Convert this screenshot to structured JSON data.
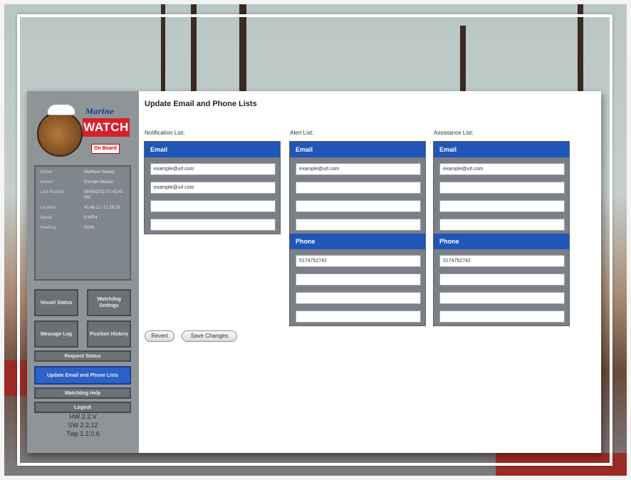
{
  "sidebar": {
    "logo": {
      "brand_top": "Marine",
      "brand_main": "WATCH",
      "brand_badge": "On Board"
    },
    "status": [
      {
        "key": "Owner",
        "value": "Matthew Healey"
      },
      {
        "key": "Vessel",
        "value": "Energie Nessel"
      },
      {
        "key": "Last Position",
        "value": "08/05/2011 07:43:43 PM"
      },
      {
        "key": "Location",
        "value": "41.48.12 -71.29.23"
      },
      {
        "key": "Speed",
        "value": "0 MPH"
      },
      {
        "key": "Heading",
        "value": "North"
      }
    ],
    "buttons": {
      "vessel_status": "Vessel Status",
      "watchdog_settings": "Watchdog Settings",
      "message_log": "Message Log",
      "position_history": "Position History",
      "request_status": "Request Status",
      "update_lists": "Update Email and Phone Lists",
      "watchdog_help": "Watchdog Help",
      "logout": "Logout"
    },
    "versions": {
      "hw": "HW 2.2.V",
      "sw": "SW 2.2.12",
      "twp": "Twp 1.2.0.6"
    }
  },
  "main": {
    "title": "Update Email and Phone Lists",
    "notification": {
      "label": "Notification List:",
      "email_header": "Email",
      "emails": [
        "example@url.com",
        "example@url.com",
        "",
        ""
      ]
    },
    "alert": {
      "label": "Alert List:",
      "email_header": "Email",
      "emails": [
        "example@url.com",
        "",
        "",
        ""
      ],
      "phone_header": "Phone",
      "phones": [
        "5174752742",
        "",
        "",
        ""
      ]
    },
    "assistance": {
      "label": "Assistance List:",
      "email_header": "Email",
      "emails": [
        "example@url.com",
        "",
        "",
        ""
      ],
      "phone_header": "Phone",
      "phones": [
        "5174752742",
        "",
        "",
        ""
      ]
    },
    "actions": {
      "revert": "Revert",
      "save": "Save Changes"
    }
  },
  "colors": {
    "accent": "#1f56b8",
    "active_nav": "#2a62c8",
    "sidebar_bg": "#8f9498",
    "brand_red": "#d8202a"
  }
}
